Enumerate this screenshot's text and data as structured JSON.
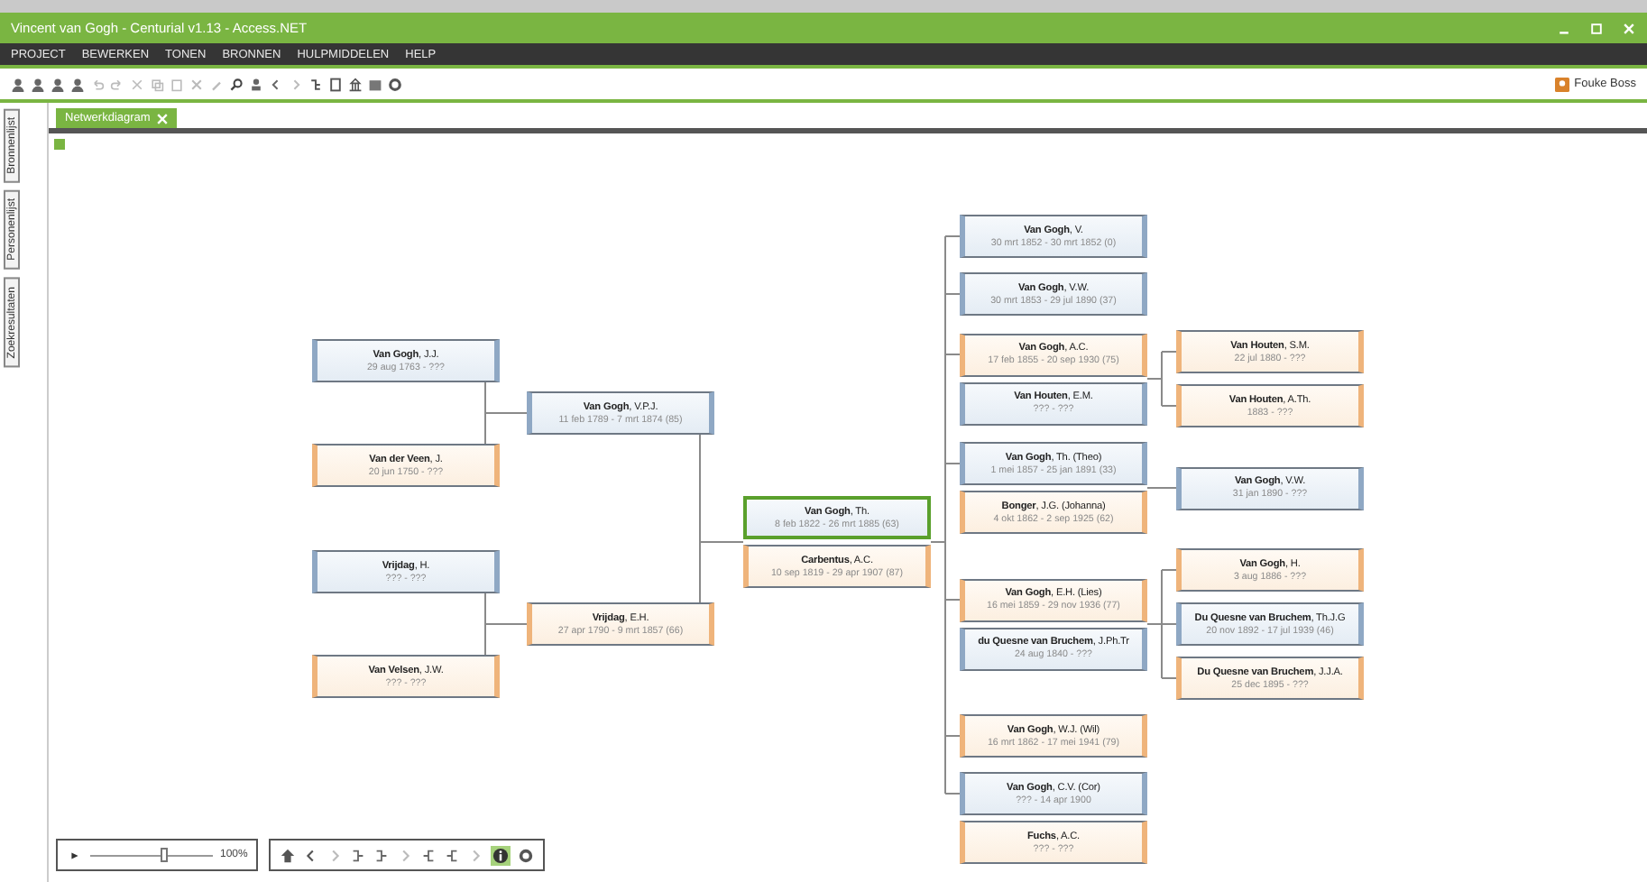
{
  "window": {
    "title": "Vincent van Gogh - Centurial v1.13 - Access.NET"
  },
  "menu": [
    "PROJECT",
    "BEWERKEN",
    "TONEN",
    "BRONNEN",
    "HULPMIDDELEN",
    "HELP"
  ],
  "user": {
    "name": "Fouke Boss"
  },
  "side_tabs": [
    "Bronnenlijst",
    "Personenlijst",
    "Zoekresultaten"
  ],
  "tabs": [
    {
      "label": "Netwerkdiagram",
      "selected": true
    }
  ],
  "diagram": {
    "root": {
      "person": {
        "name": "**Van Gogh**, Th.",
        "dates": "8 feb 1822 - 26 mrt 1885 (63)",
        "kind": "male",
        "selected": true
      },
      "spouse": {
        "name": "**Carbentus**, A.C.",
        "dates": "10 sep 1819 - 29 apr 1907 (87)",
        "kind": "female",
        "selected": false
      }
    },
    "parents": [
      {
        "person": {
          "name": "**Van Gogh**, V.P.J.",
          "dates": "11 feb 1789 - 7 mrt 1874 (85)",
          "kind": "male",
          "selected": false
        },
        "parents": [
          {
            "name": "**Van Gogh**, J.J.",
            "dates": "29 aug 1763 - ???",
            "kind": "male",
            "selected": false
          },
          {
            "name": "**Van der Veen**, J.",
            "dates": "20 jun 1750 - ???",
            "kind": "female",
            "selected": false
          }
        ]
      },
      {
        "person": {
          "name": "**Vrijdag**, E.H.",
          "dates": "27 apr 1790 - 9 mrt 1857 (66)",
          "kind": "female",
          "selected": false
        },
        "parents": [
          {
            "name": "**Vrijdag**, H.",
            "dates": "??? - ???",
            "kind": "male",
            "selected": false
          },
          {
            "name": "**Van Velsen**, J.W.",
            "dates": "??? - ???",
            "kind": "female",
            "selected": false
          }
        ]
      }
    ],
    "children": [
      {
        "person": {
          "name": "**Van Gogh**, V.",
          "dates": "30 mrt 1852 - 30 mrt 1852 (0)",
          "kind": "male",
          "selected": false
        }
      },
      {
        "person": {
          "name": "**Van Gogh**, V.W.",
          "dates": "30 mrt 1853 - 29 jul 1890 (37)",
          "kind": "male",
          "selected": false
        }
      },
      {
        "person": {
          "name": "**Van Gogh**, A.C.",
          "dates": "17 feb 1855 - 20 sep 1930 (75)",
          "kind": "female",
          "selected": false
        },
        "spouse": {
          "name": "**Van Houten**, E.M.",
          "dates": "??? - ???",
          "kind": "male",
          "selected": false
        },
        "children": [
          {
            "name": "**Van Houten**, S.M.",
            "dates": "22 jul 1880 - ???",
            "kind": "female",
            "selected": false
          },
          {
            "name": "**Van Houten**, A.Th.",
            "dates": "1883 - ???",
            "kind": "female",
            "selected": false
          }
        ]
      },
      {
        "person": {
          "name": "**Van Gogh**, Th. (Theo)",
          "dates": "1 mei 1857 - 25 jan 1891 (33)",
          "kind": "male",
          "selected": false
        },
        "spouse": {
          "name": "**Bonger**, J.G. (Johanna)",
          "dates": "4 okt 1862 - 2 sep 1925 (62)",
          "kind": "female",
          "selected": false
        },
        "children": [
          {
            "name": "**Van Gogh**, V.W.",
            "dates": "31 jan 1890 - ???",
            "kind": "male",
            "selected": false
          }
        ]
      },
      {
        "person": {
          "name": "**Van Gogh**, E.H. (Lies)",
          "dates": "16 mei 1859 - 29 nov 1936 (77)",
          "kind": "female",
          "selected": false
        },
        "spouse": {
          "name": "**du Quesne van Bruchem**, J.Ph.Tr",
          "dates": "24 aug 1840 - ???",
          "kind": "male",
          "selected": false
        },
        "children": [
          {
            "name": "**Van Gogh**, H.",
            "dates": "3 aug 1886 - ???",
            "kind": "female",
            "selected": false
          },
          {
            "name": "**Du Quesne van Bruchem**, Th.J.G",
            "dates": "20 nov 1892 - 17 jul 1939 (46)",
            "kind": "male",
            "selected": false
          },
          {
            "name": "**Du Quesne van Bruchem**, J.J.A.",
            "dates": "25 dec 1895 - ???",
            "kind": "female",
            "selected": false
          }
        ]
      },
      {
        "person": {
          "name": "**Van Gogh**, W.J. (Wil)",
          "dates": "16 mrt 1862 - 17 mei 1941 (79)",
          "kind": "female",
          "selected": false
        }
      },
      {
        "person": {
          "name": "**Van Gogh**, C.V. (Cor)",
          "dates": "??? - 14 apr 1900",
          "kind": "male",
          "selected": false
        },
        "spouse": {
          "name": "**Fuchs**, A.C.",
          "dates": "??? - ???",
          "kind": "female",
          "selected": false
        }
      }
    ]
  },
  "zoom": {
    "level": 0.6,
    "reading": "100%"
  },
  "info_button": {
    "on": true
  }
}
